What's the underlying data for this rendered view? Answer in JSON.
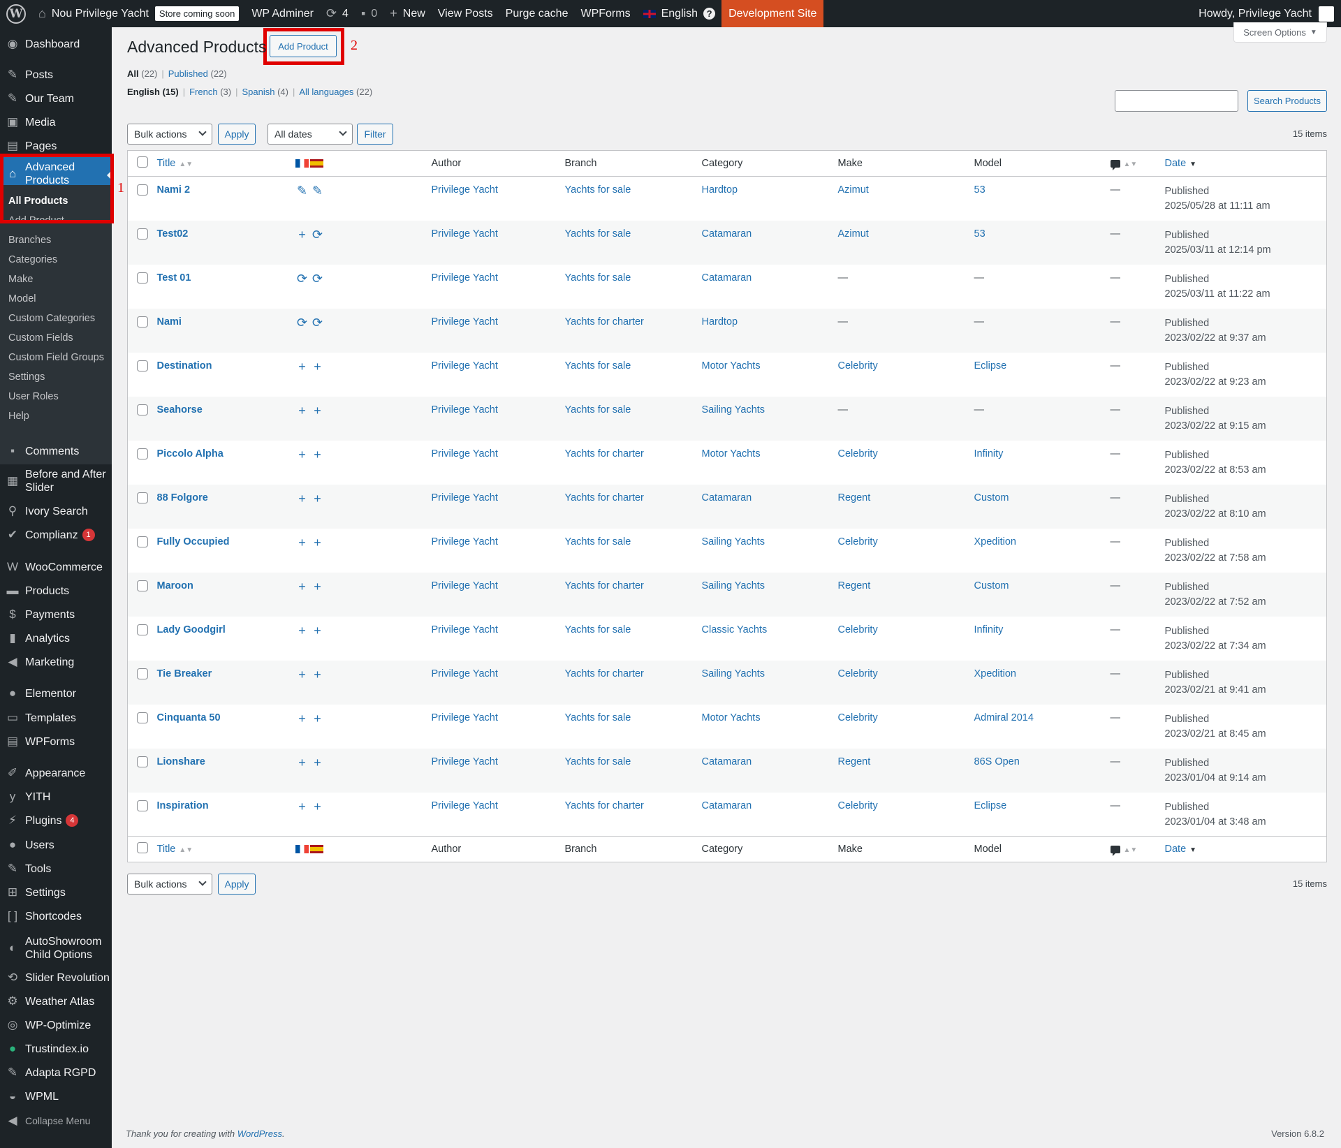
{
  "adminbar": {
    "site_name": "Nou Privilege Yacht",
    "store_badge": "Store coming soon",
    "wp_adminer": "WP Adminer",
    "updates_count": "4",
    "comments_count": "0",
    "new_label": "New",
    "view_posts": "View Posts",
    "purge_cache": "Purge cache",
    "wpforms": "WPForms",
    "language": "English",
    "dev_site": "Development Site",
    "howdy": "Howdy, Privilege Yacht"
  },
  "sidebar": {
    "dashboard": "Dashboard",
    "posts": "Posts",
    "our_team": "Our Team",
    "media": "Media",
    "pages": "Pages",
    "advanced_products": "Advanced Products",
    "submenu": [
      "All Products",
      "Add Product",
      "Branches",
      "Categories",
      "Make",
      "Model",
      "Custom Categories",
      "Custom Fields",
      "Custom Field Groups",
      "Settings",
      "User Roles",
      "Help"
    ],
    "comments": "Comments",
    "before_after": "Before and After Slider",
    "ivory_search": "Ivory Search",
    "complianz": "Complianz",
    "complianz_count": "1",
    "woocommerce": "WooCommerce",
    "products": "Products",
    "payments": "Payments",
    "analytics": "Analytics",
    "marketing": "Marketing",
    "elementor": "Elementor",
    "templates": "Templates",
    "wpforms": "WPForms",
    "appearance": "Appearance",
    "yith": "YITH",
    "plugins": "Plugins",
    "plugins_count": "4",
    "users": "Users",
    "tools": "Tools",
    "settings": "Settings",
    "shortcodes": "Shortcodes",
    "autoshowroom": "AutoShowroom Child Options",
    "slider_revolution": "Slider Revolution",
    "weather_atlas": "Weather Atlas",
    "wp_optimize": "WP-Optimize",
    "trustindex": "Trustindex.io",
    "adapta": "Adapta RGPD",
    "wpml": "WPML",
    "collapse": "Collapse Menu"
  },
  "annotations": {
    "one": "1",
    "two": "2"
  },
  "page": {
    "title": "Advanced Products",
    "add_button": "Add Product",
    "screen_options": "Screen Options",
    "views": {
      "all": "All",
      "all_count": "(22)",
      "published": "Published",
      "published_count": "(22)"
    },
    "langs": {
      "english": "English",
      "english_count": "(15)",
      "french": "French",
      "french_count": "(3)",
      "spanish": "Spanish",
      "spanish_count": "(4)",
      "all_languages": "All languages",
      "all_languages_count": "(22)"
    },
    "search_button": "Search Products",
    "bulk_actions": "Bulk actions",
    "apply": "Apply",
    "all_dates": "All dates",
    "filter": "Filter",
    "items_count": "15 items"
  },
  "table": {
    "columns": {
      "title": "Title",
      "author": "Author",
      "branch": "Branch",
      "category": "Category",
      "make": "Make",
      "model": "Model",
      "date": "Date"
    },
    "rows": [
      {
        "title": "Nami 2",
        "icons": "edit",
        "author": "Privilege Yacht",
        "branch": "Yachts for sale",
        "category": "Hardtop",
        "make": "Azimut",
        "model": "53",
        "comments": "—",
        "status": "Published",
        "date": "2025/05/28 at 11:11 am"
      },
      {
        "title": "Test02",
        "icons": "add-sync",
        "author": "Privilege Yacht",
        "branch": "Yachts for sale",
        "category": "Catamaran",
        "make": "Azimut",
        "model": "53",
        "comments": "—",
        "status": "Published",
        "date": "2025/03/11 at 12:14 pm"
      },
      {
        "title": "Test 01",
        "icons": "sync",
        "author": "Privilege Yacht",
        "branch": "Yachts for sale",
        "category": "Catamaran",
        "make": "—",
        "model": "—",
        "comments": "—",
        "status": "Published",
        "date": "2025/03/11 at 11:22 am"
      },
      {
        "title": "Nami",
        "icons": "sync",
        "author": "Privilege Yacht",
        "branch": "Yachts for charter",
        "category": "Hardtop",
        "make": "—",
        "model": "—",
        "comments": "—",
        "status": "Published",
        "date": "2023/02/22 at 9:37 am"
      },
      {
        "title": "Destination",
        "icons": "add",
        "author": "Privilege Yacht",
        "branch": "Yachts for sale",
        "category": "Motor Yachts",
        "make": "Celebrity",
        "model": "Eclipse",
        "comments": "—",
        "status": "Published",
        "date": "2023/02/22 at 9:23 am"
      },
      {
        "title": "Seahorse",
        "icons": "add",
        "author": "Privilege Yacht",
        "branch": "Yachts for sale",
        "category": "Sailing Yachts",
        "make": "—",
        "model": "—",
        "comments": "—",
        "status": "Published",
        "date": "2023/02/22 at 9:15 am"
      },
      {
        "title": "Piccolo Alpha",
        "icons": "add",
        "author": "Privilege Yacht",
        "branch": "Yachts for charter",
        "category": "Motor Yachts",
        "make": "Celebrity",
        "model": "Infinity",
        "comments": "—",
        "status": "Published",
        "date": "2023/02/22 at 8:53 am"
      },
      {
        "title": "88 Folgore",
        "icons": "add",
        "author": "Privilege Yacht",
        "branch": "Yachts for charter",
        "category": "Catamaran",
        "make": "Regent",
        "model": "Custom",
        "comments": "—",
        "status": "Published",
        "date": "2023/02/22 at 8:10 am"
      },
      {
        "title": "Fully Occupied",
        "icons": "add",
        "author": "Privilege Yacht",
        "branch": "Yachts for sale",
        "category": "Sailing Yachts",
        "make": "Celebrity",
        "model": "Xpedition",
        "comments": "—",
        "status": "Published",
        "date": "2023/02/22 at 7:58 am"
      },
      {
        "title": "Maroon",
        "icons": "add",
        "author": "Privilege Yacht",
        "branch": "Yachts for charter",
        "category": "Sailing Yachts",
        "make": "Regent",
        "model": "Custom",
        "comments": "—",
        "status": "Published",
        "date": "2023/02/22 at 7:52 am"
      },
      {
        "title": "Lady Goodgirl",
        "icons": "add",
        "author": "Privilege Yacht",
        "branch": "Yachts for sale",
        "category": "Classic Yachts",
        "make": "Celebrity",
        "model": "Infinity",
        "comments": "—",
        "status": "Published",
        "date": "2023/02/22 at 7:34 am"
      },
      {
        "title": "Tie Breaker",
        "icons": "add",
        "author": "Privilege Yacht",
        "branch": "Yachts for charter",
        "category": "Sailing Yachts",
        "make": "Celebrity",
        "model": "Xpedition",
        "comments": "—",
        "status": "Published",
        "date": "2023/02/21 at 9:41 am"
      },
      {
        "title": "Cinquanta 50",
        "icons": "add",
        "author": "Privilege Yacht",
        "branch": "Yachts for sale",
        "category": "Motor Yachts",
        "make": "Celebrity",
        "model": "Admiral 2014",
        "comments": "—",
        "status": "Published",
        "date": "2023/02/21 at 8:45 am"
      },
      {
        "title": "Lionshare",
        "icons": "add",
        "author": "Privilege Yacht",
        "branch": "Yachts for sale",
        "category": "Catamaran",
        "make": "Regent",
        "model": "86S Open",
        "comments": "—",
        "status": "Published",
        "date": "2023/01/04 at 9:14 am"
      },
      {
        "title": "Inspiration",
        "icons": "add",
        "author": "Privilege Yacht",
        "branch": "Yachts for charter",
        "category": "Catamaran",
        "make": "Celebrity",
        "model": "Eclipse",
        "comments": "—",
        "status": "Published",
        "date": "2023/01/04 at 3:48 am"
      }
    ]
  },
  "footer": {
    "thanks": "Thank you for creating with ",
    "wordpress": "WordPress",
    "thanks_end": ".",
    "version": "Version 6.8.2"
  }
}
